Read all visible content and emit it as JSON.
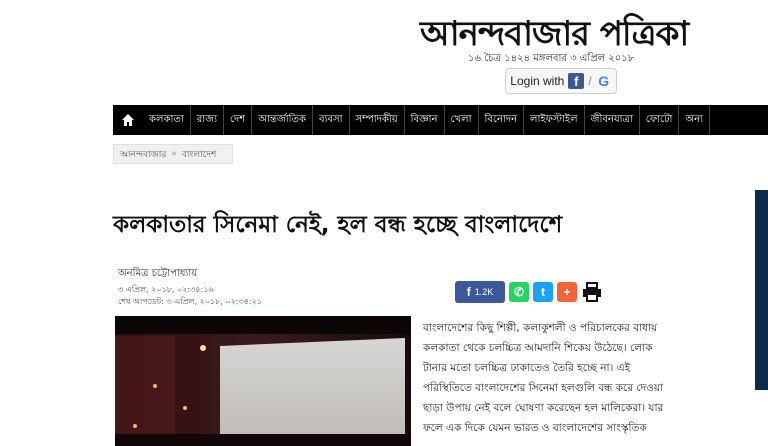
{
  "masthead": {
    "title": "আনন্দবাজার পত্রিকা",
    "dateline": "১৬ চৈত্র ১৪২৪ মঙ্গলবার ৩ এপ্রিল ২০১৮"
  },
  "login": {
    "label": "Login with",
    "fb": "f",
    "google": "G"
  },
  "nav": {
    "items": [
      "কলকাতা",
      "রাজ্য",
      "দেশ",
      "আন্তর্জাতিক",
      "ব্যবসা",
      "সম্পাদকীয়",
      "বিজ্ঞান",
      "খেলা",
      "বিনোদন",
      "লাইফস্টাইল",
      "জীবনযাত্রা",
      "ফোটো",
      "অন্য"
    ]
  },
  "breadcrumb": {
    "home": "আনন্দবাজার",
    "separator": "»",
    "current": "বাংলাদেশ"
  },
  "article": {
    "headline": "কলকাতার সিনেমা নেই, হল বন্ধ হচ্ছে বাংলাদেশে",
    "author": "অনমিত্র চট্টোপাধ্যায়",
    "published": "৩ এপ্রিল, ২০১৮, ০২:৩৪:১৬",
    "updated": "শেষ আপডেট: ৩ এপ্রিল, ২০১৮, ০২:৩৪:২১",
    "paragraphs": [
      "বাংলাদেশের কিছু শিল্পী, কলাকুশলী ও পরিচালকের বাধায়",
      "কলকাতা থেকে চলচ্চিত্র আমদানি শিকেয় উঠেছে। লোক",
      "টানার মতো চলচ্চিত্র ঢাকাতেও তৈরি হচ্ছে না। এই",
      "পরিস্থিতিতে বাংলাদেশের সিনেমা হলগুলি বন্ধ করে দেওয়া",
      "ছাড়া উপায় নেই বলে ঘোষণা করেছেন হল মালিকেরা। যার",
      "ফলে এক দিকে যেমন ভারত ও বাংলাদেশের সাংস্কৃতিক"
    ]
  },
  "share": {
    "fb_count": "1.2K",
    "wa": "✆",
    "tw": "t",
    "plus": "+"
  }
}
